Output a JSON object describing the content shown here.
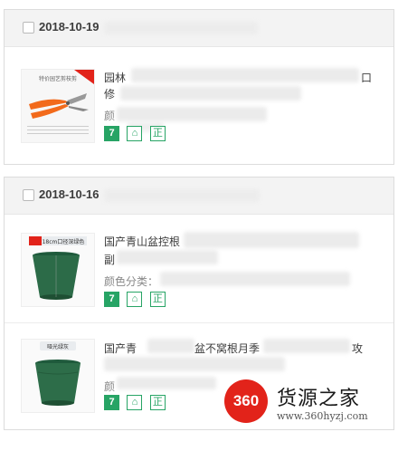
{
  "orders": [
    {
      "date": "2018-10-19",
      "products": [
        {
          "title_start": "园林",
          "title_end": "口",
          "title_line2": "修",
          "attr_start": "颜",
          "thumb_icon": "pruning-shears-image",
          "thumb_caption": "特价园艺剪枝剪",
          "badges": {
            "seven": "7",
            "guard": "⌂",
            "zheng": "正"
          }
        }
      ]
    },
    {
      "date": "2018-10-16",
      "products": [
        {
          "title_start": "国产青山盆控根",
          "title_line2": "副",
          "attr_start": "颜色分类：",
          "thumb_icon": "green-flower-pot-image",
          "thumb_caption": "18cm口径深绿色",
          "badges": {
            "seven": "7",
            "guard": "⌂",
            "zheng": "正"
          }
        },
        {
          "title_start": "国产青",
          "title_mid": "盆不窝根月季",
          "title_end": "攻",
          "attr_start": "颜",
          "thumb_icon": "green-flower-pot-image",
          "thumb_caption": "哑光绿灰",
          "badges": {
            "seven": "7",
            "guard": "⌂",
            "zheng": "正"
          }
        }
      ]
    }
  ],
  "watermark": {
    "logo_text": "360",
    "site_name": "货源之家",
    "url": "www.360hyzj.com",
    "brand_color": "#e2231a"
  },
  "colors": {
    "badge_green": "#27a465",
    "header_bg": "#f3f3f3"
  }
}
